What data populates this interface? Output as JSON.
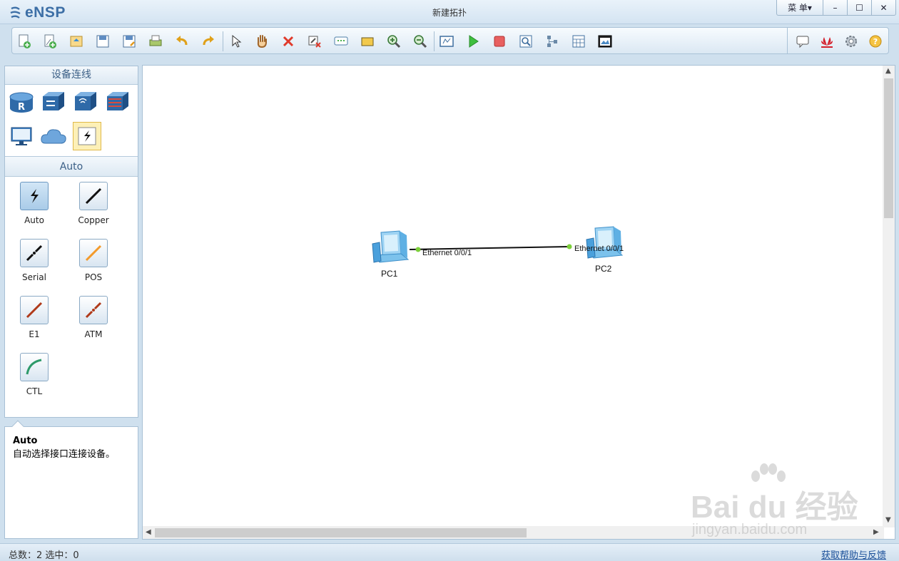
{
  "app": {
    "name": "eNSP",
    "window_title": "新建拓扑"
  },
  "window_controls": {
    "menu_label": "菜 单▾",
    "minimize": "–",
    "maximize": "☐",
    "close": "✕"
  },
  "toolbar": {
    "tools": [
      "new-topology-icon",
      "new-file-icon",
      "open-icon",
      "save-icon",
      "save-as-icon",
      "print-icon",
      "undo-icon",
      "redo-icon",
      "select-icon",
      "pan-hand-icon",
      "delete-icon",
      "delete-link-icon",
      "text-note-icon",
      "rectangle-icon",
      "zoom-in-icon",
      "zoom-out-icon",
      "fit-view-icon",
      "start-device-icon",
      "stop-device-icon",
      "capture-icon",
      "topology-tree-icon",
      "grid-icon",
      "screenshot-icon"
    ],
    "right_tools": [
      "chat-icon",
      "huawei-logo-icon",
      "settings-gear-icon",
      "help-icon"
    ]
  },
  "left_panel": {
    "header": "设备连线",
    "device_categories": [
      "router-icon",
      "switch-icon",
      "wireless-icon",
      "firewall-icon",
      "pc-terminal-icon",
      "cloud-icon",
      "connection-icon"
    ],
    "cable_section_title": "Auto",
    "cables": [
      {
        "label": "Auto",
        "color": "#111111"
      },
      {
        "label": "Copper",
        "color": "#111111"
      },
      {
        "label": "Serial",
        "color": "#111111"
      },
      {
        "label": "POS",
        "color": "#f39a2b"
      },
      {
        "label": "E1",
        "color": "#b03a1a"
      },
      {
        "label": "ATM",
        "color": "#b03a1a"
      },
      {
        "label": "CTL",
        "color": "#2e9a6a"
      }
    ]
  },
  "description": {
    "title": "Auto",
    "text": "自动选择接口连接设备。"
  },
  "topology": {
    "nodes": [
      {
        "name": "PC1",
        "port": "Ethernet 0/0/1"
      },
      {
        "name": "PC2",
        "port": "Ethernet 0/0/1"
      }
    ]
  },
  "status": {
    "left": "总数：2 选中：0",
    "help_link": "获取帮助与反馈"
  },
  "watermark": {
    "text": "Bai du 经验",
    "sub": "jingyan.baidu.com"
  },
  "colors": {
    "accent": "#3d6fa6",
    "link_dot": "#7ccf3a"
  }
}
